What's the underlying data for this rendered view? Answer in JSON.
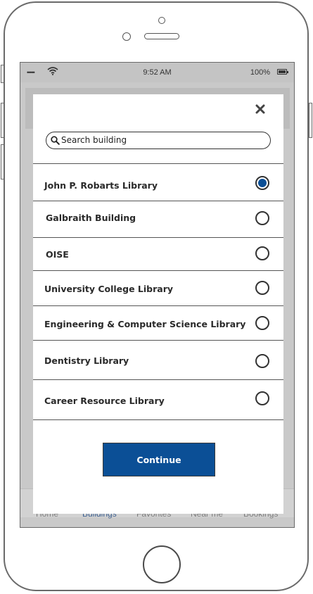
{
  "status_bar": {
    "signal": "•••••",
    "time": "9:52 AM",
    "battery": "100%"
  },
  "tab_bar": {
    "items": [
      {
        "label": "Home",
        "active": false
      },
      {
        "label": "Buildings",
        "active": true
      },
      {
        "label": "Favorites",
        "active": false
      },
      {
        "label": "Near me",
        "active": false
      },
      {
        "label": "Bookings",
        "active": false
      }
    ]
  },
  "modal": {
    "close_icon": "close-icon",
    "search": {
      "placeholder": "Search building",
      "value": "",
      "icon": "search-icon"
    },
    "buildings": [
      {
        "label": "John P. Robarts Library",
        "selected": true
      },
      {
        "label": "Galbraith Building",
        "selected": false
      },
      {
        "label": "OISE",
        "selected": false
      },
      {
        "label": "University College Library",
        "selected": false
      },
      {
        "label": "Engineering & Computer Science Library",
        "selected": false
      },
      {
        "label": "Dentistry Library",
        "selected": false
      },
      {
        "label": "Career Resource Library",
        "selected": false
      }
    ],
    "continue_label": "Continue"
  },
  "colors": {
    "accent": "#0b4f96",
    "screen_dim": "#c9c9c9",
    "frame": "#6a6a6a"
  }
}
